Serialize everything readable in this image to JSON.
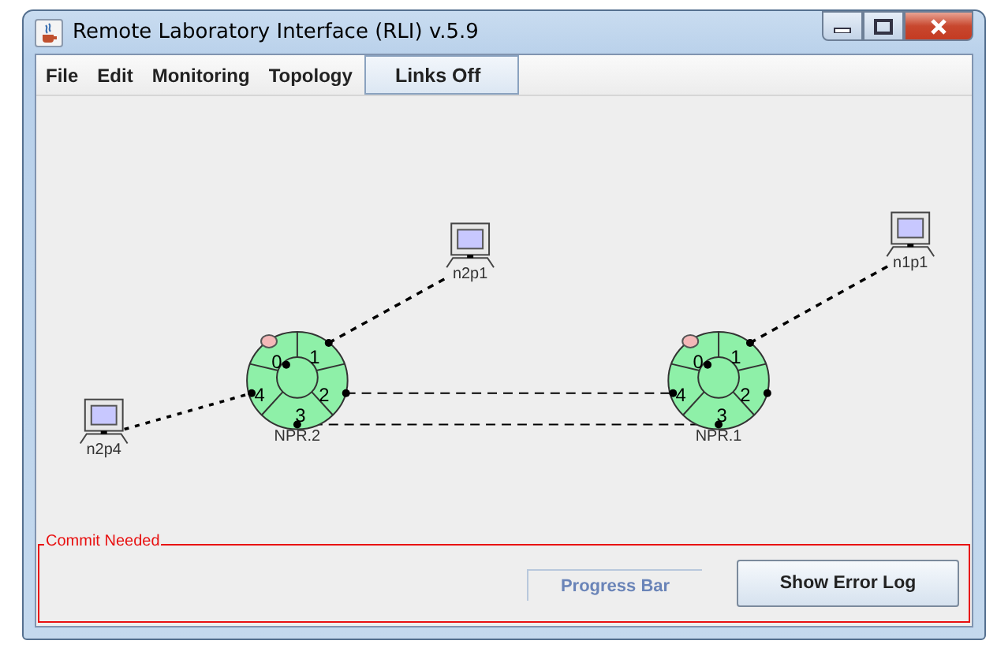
{
  "window": {
    "title": "Remote Laboratory Interface (RLI) v.5.9"
  },
  "menu": [
    {
      "label": "File",
      "kind": "menu"
    },
    {
      "label": "Edit",
      "kind": "menu"
    },
    {
      "label": "Monitoring",
      "kind": "menu"
    },
    {
      "label": "Topology",
      "kind": "menu"
    },
    {
      "label": "Links Off",
      "kind": "toggle",
      "selected": true
    }
  ],
  "topology": {
    "routers": [
      {
        "label": "NPR.2",
        "ports": [
          "0",
          "1",
          "2",
          "3",
          "4"
        ]
      },
      {
        "label": "NPR.1",
        "ports": [
          "0",
          "1",
          "2",
          "3",
          "4"
        ]
      }
    ],
    "hosts": [
      {
        "label": "n2p1"
      },
      {
        "label": "n2p4"
      },
      {
        "label": "n1p1"
      }
    ]
  },
  "commit_panel": {
    "title": "Commit Needed",
    "progress": {
      "label": "Progress Bar",
      "level": 0
    },
    "button": "Show Error Log"
  }
}
